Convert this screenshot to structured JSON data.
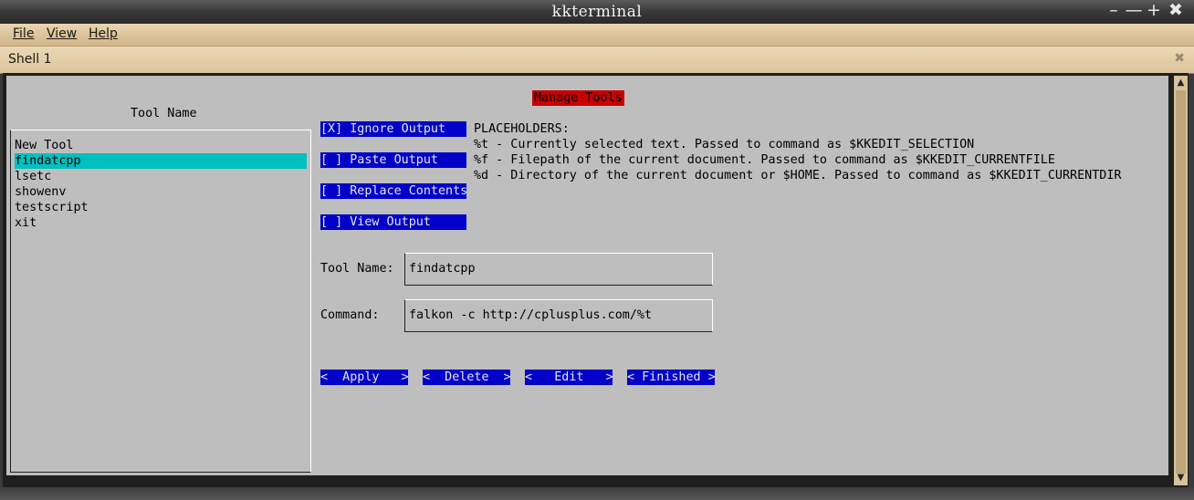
{
  "window": {
    "title": "kkterminal"
  },
  "menu": {
    "file": "File",
    "view": "View",
    "help": "Help"
  },
  "tab": {
    "label": "Shell 1"
  },
  "dialog": {
    "title": "Manage Tools"
  },
  "tool_list": {
    "heading": "Tool Name",
    "items": [
      "New Tool",
      "findatcpp",
      "lsetc",
      "showenv",
      "testscript",
      "xit"
    ],
    "selected": "findatcpp"
  },
  "options": {
    "ignore_output": "[X] Ignore Output",
    "paste_output": "[ ] Paste Output",
    "replace_contents": "[ ] Replace Contents",
    "view_output": "[ ] View Output"
  },
  "placeholders": {
    "heading": "PLACEHOLDERS:",
    "lines": [
      "%t - Currently selected text. Passed to command as $KKEDIT_SELECTION",
      "%f - Filepath of the current document. Passed to command as $KKEDIT_CURRENTFILE",
      "%d - Directory of the current document or $HOME. Passed to command as $KKEDIT_CURRENTDIR"
    ]
  },
  "form": {
    "tool_name_label": "Tool Name:",
    "tool_name_value": "findatcpp",
    "command_label": "Command:",
    "command_value": "falkon -c http://cplusplus.com/%t"
  },
  "buttons": {
    "apply": "<  Apply   >",
    "delete": "<  Delete  >",
    "edit": "<   Edit   >",
    "finished": "< Finished >"
  },
  "colors": {
    "dialog_title_bg": "#c80000",
    "button_bg": "#0000c8",
    "selection_bg": "#00c0c0",
    "terminal_bg": "#bebebe"
  }
}
